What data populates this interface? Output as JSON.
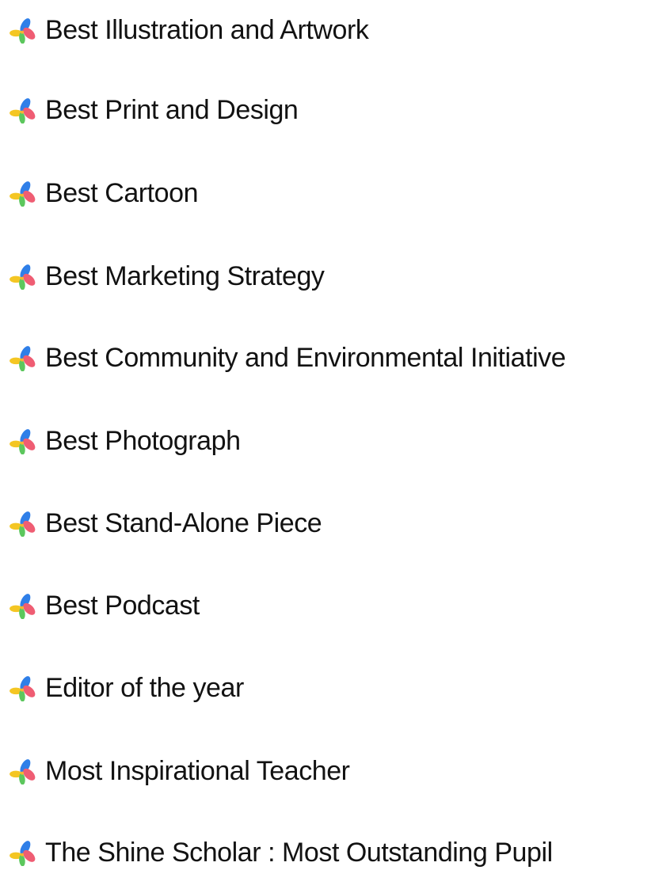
{
  "awards": {
    "icon": "pinwheel-icon",
    "items": [
      {
        "label": "Best Illustration and Artwork"
      },
      {
        "label": "Best Print and Design"
      },
      {
        "label": "Best Cartoon"
      },
      {
        "label": "Best Marketing Strategy"
      },
      {
        "label": "Best Community and Environmental Initiative"
      },
      {
        "label": "Best Photograph"
      },
      {
        "label": "Best Stand-Alone Piece"
      },
      {
        "label": "Best Podcast"
      },
      {
        "label": "Editor of the year"
      },
      {
        "label": "Most Inspirational Teacher"
      },
      {
        "label": "The Shine Scholar : Most Outstanding Pupil"
      }
    ],
    "colors": {
      "blue": "#2f7fe8",
      "pink": "#ef5d73",
      "yellow": "#f4c623",
      "green": "#5cc75d"
    }
  }
}
